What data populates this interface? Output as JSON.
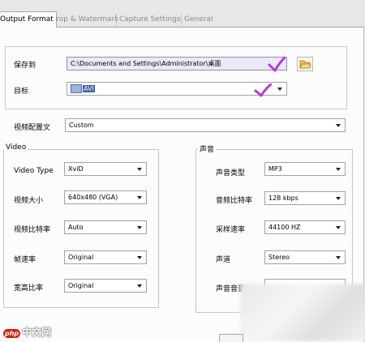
{
  "tabs": [
    {
      "label": "Output Format",
      "active": true
    },
    {
      "label": "Crop & Watermark",
      "active": false
    },
    {
      "label": "Capture Settings",
      "active": false
    },
    {
      "label": "General",
      "active": false
    }
  ],
  "output": {
    "save_to_label": "保存到",
    "save_to_value": "C:\\Documents and Settings\\Administrator\\桌面",
    "target_label": "目标",
    "target_value": "AVI"
  },
  "profile": {
    "label": "视频配置文",
    "value": "Custom"
  },
  "video": {
    "legend": "Video",
    "rows": [
      {
        "label": "Video Type",
        "value": "XviD"
      },
      {
        "label": "视频大小",
        "value": "640x480 (VGA)"
      },
      {
        "label": "视频比特率",
        "value": "Auto"
      },
      {
        "label": "帧速率",
        "value": "Original"
      },
      {
        "label": "宽高比率",
        "value": "Original"
      }
    ]
  },
  "audio": {
    "legend": "声音",
    "rows": [
      {
        "label": "声音类型",
        "value": "MP3"
      },
      {
        "label": "音频比特率",
        "value": "128 kbps"
      },
      {
        "label": "采样速率",
        "value": "44100 HZ"
      },
      {
        "label": "声道",
        "value": "Stereo"
      },
      {
        "label": "声音音量",
        "value": ""
      }
    ]
  },
  "watermark": {
    "brand": "中文网",
    "badge": "php"
  },
  "colors": {
    "check_mark": "#b43bd4",
    "selection": "#3b5ea8",
    "brand_red": "#d81e06"
  }
}
